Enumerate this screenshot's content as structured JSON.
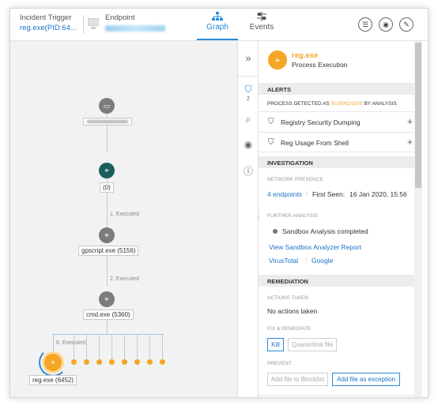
{
  "topbar": {
    "incident_label": "Incident Trigger",
    "incident_link": "reg.exe(PID:64...",
    "endpoint_label": "Endpoint",
    "tabs": [
      {
        "label": "Graph",
        "icon": "graph-icon",
        "active": true
      },
      {
        "label": "Events",
        "icon": "events-icon",
        "active": false
      }
    ],
    "actions": [
      "list-icon",
      "eye-icon",
      "edit-icon"
    ]
  },
  "graph": {
    "nodes": [
      {
        "label": "(0)",
        "color": "teal"
      },
      {
        "label": "gpscript.exe (5156)",
        "color": "grey"
      },
      {
        "label": "cmd.exe (5360)",
        "color": "grey"
      },
      {
        "label": "reg.exe (6452)",
        "color": "orange"
      }
    ],
    "edges": [
      "1. Executed",
      "2. Executed",
      "6. Executed"
    ]
  },
  "rail": {
    "collapse_icon": "double-chevron-right-icon",
    "alerts_count": "2"
  },
  "panel": {
    "process_name": "reg.exe",
    "process_subtitle": "Process Execution",
    "alerts_header": "ALERTS",
    "alerts_desc_prefix": "PROCESS DETECTED AS",
    "alerts_desc_highlight": "SUSPICIOUS",
    "alerts_desc_suffix": "BY ANALYSIS",
    "alerts": [
      {
        "label": "Registry Security Dumping"
      },
      {
        "label": "Reg Usage From Shell"
      }
    ],
    "investigation_header": "INVESTIGATION",
    "network_presence_label": "NETWORK PRESENCE",
    "endpoints_link": "4 endpoints",
    "first_seen_label": "First Seen:",
    "first_seen_value": "16 Jan 2020, 15:56",
    "further_analysis_label": "FURTHER ANALYSIS",
    "sandbox_status": "Sandbox Analysis completed",
    "sandbox_report_link": "View Sandbox Analyzer Report",
    "virustotal_link": "VirusTotal",
    "google_link": "Google",
    "remediation_header": "REMEDIATION",
    "actions_taken_label": "ACTIONS TAKEN",
    "actions_taken_value": "No actions taken",
    "fix_label": "FIX & REMEDIATE",
    "kill_button": "Kill",
    "quarantine_button": "Quarantine file",
    "prevent_label": "PREVENT",
    "blocklist_button": "Add file to Blocklist",
    "exception_button": "Add file as exception"
  },
  "colors": {
    "accent": "#2a8ad8",
    "process_orange": "#f5a623",
    "teal_node": "#1b5e5c",
    "grey_node": "#7c7c7c"
  }
}
